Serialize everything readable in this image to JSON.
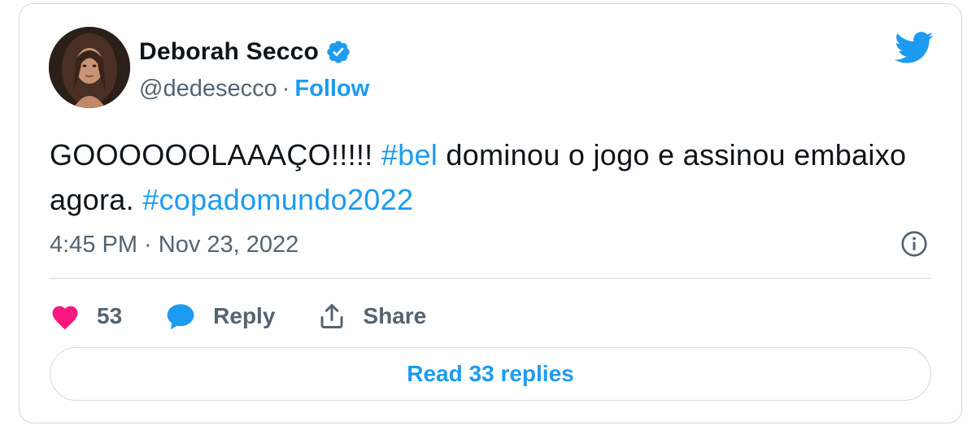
{
  "author": {
    "display_name": "Deborah Secco",
    "handle": "@dedesecco",
    "separator": "·",
    "follow_label": "Follow",
    "verified": true
  },
  "tweet": {
    "text_part1": "GOOOOOOLAAAÇO!!!!! ",
    "hashtag1": "#bel",
    "text_part2": " dominou o jogo e assinou embaixo agora. ",
    "hashtag2": "#copadomundo2022",
    "timestamp": "4:45 PM · Nov 23, 2022"
  },
  "actions": {
    "like_count": "53",
    "reply_label": "Reply",
    "share_label": "Share"
  },
  "read_replies_label": "Read 33 replies",
  "colors": {
    "brand_blue": "#1d9bf0",
    "like_pink": "#f91880",
    "muted_text": "#536471",
    "border": "#cfd9de"
  },
  "icons": [
    "avatar-photo",
    "verified-badge-icon",
    "twitter-bird-icon",
    "info-icon",
    "heart-icon",
    "reply-bubble-icon",
    "share-icon"
  ]
}
